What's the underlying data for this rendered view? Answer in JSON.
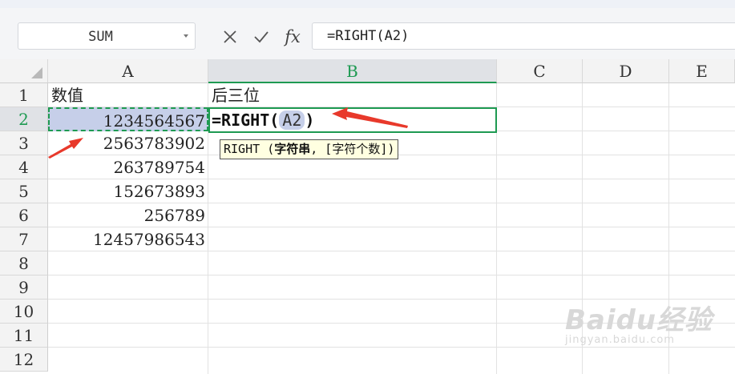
{
  "namebox": {
    "value": "SUM",
    "dropdown_icon": "chevron-down-icon"
  },
  "formula_bar": {
    "cancel_icon": "close-icon",
    "confirm_icon": "check-icon",
    "fx_label": "fx",
    "formula": "=RIGHT(A2)"
  },
  "columns": [
    "A",
    "B",
    "C",
    "D",
    "E"
  ],
  "active_column": "B",
  "rows": [
    "1",
    "2",
    "3",
    "4",
    "5",
    "6",
    "7",
    "8",
    "9",
    "10",
    "11",
    "12"
  ],
  "active_row": "2",
  "cells": {
    "A1": "数值",
    "B1": "后三位",
    "A2": "1234564567",
    "A3": "2563783902",
    "A4": "263789754",
    "A5": "152673893",
    "A6": "256789",
    "A7": "12457986543"
  },
  "edit": {
    "prefix": "=RIGHT(",
    "ref": "A2",
    "suffix": ")"
  },
  "tooltip": {
    "func": "RIGHT",
    "open": "(",
    "arg1": "字符串",
    "sep": ",",
    "arg2": "[字符个数]",
    "close": ")"
  },
  "annotation_color": "#e8392b",
  "selection_color": "#1e9a52",
  "watermark": {
    "logo": "Baidu经验",
    "site": "jingyan.baidu.com"
  }
}
